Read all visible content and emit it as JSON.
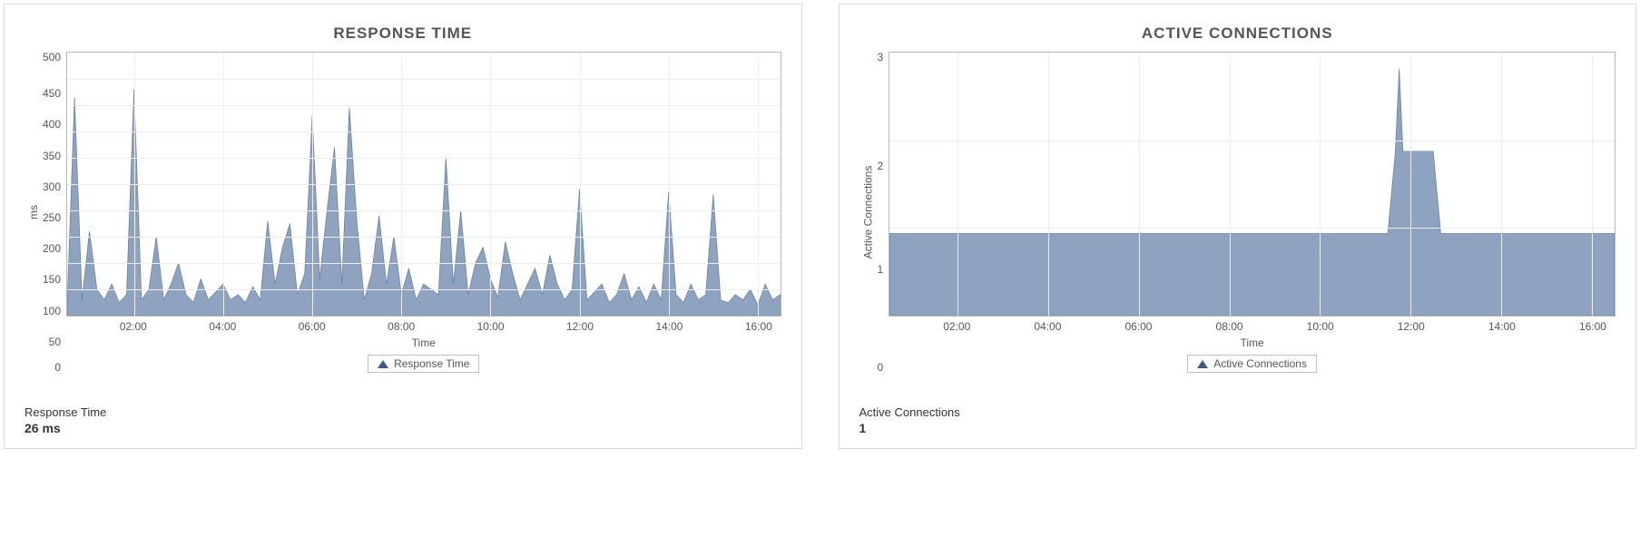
{
  "colors": {
    "series_fill": "#8da3bf",
    "series_stroke": "#6a82a3",
    "panel_border": "#d9d9d9"
  },
  "left": {
    "title": "RESPONSE TIME",
    "ylabel": "ms",
    "xlabel": "Time",
    "legend": "Response Time",
    "summary_label": "Response Time",
    "summary_value": "26 ms",
    "yticks": [
      "500",
      "450",
      "400",
      "350",
      "300",
      "250",
      "200",
      "150",
      "100",
      "50",
      "0"
    ],
    "xticks": [
      "02:00",
      "04:00",
      "06:00",
      "08:00",
      "10:00",
      "12:00",
      "14:00",
      "16:00"
    ]
  },
  "right": {
    "title": "ACTIVE CONNECTIONS",
    "ylabel": "Active Connections",
    "xlabel": "Time",
    "legend": "Active Connections",
    "summary_label": "Active Connections",
    "summary_value": "1",
    "yticks": [
      "3",
      "2",
      "1",
      "0"
    ],
    "xticks": [
      "02:00",
      "04:00",
      "06:00",
      "08:00",
      "10:00",
      "12:00",
      "14:00",
      "16:00"
    ]
  },
  "chart_data": [
    {
      "type": "area",
      "title": "RESPONSE TIME",
      "xlabel": "Time",
      "ylabel": "ms",
      "ylim": [
        0,
        500
      ],
      "xlim": [
        "00:30",
        "16:30"
      ],
      "x_tick_labels": [
        "02:00",
        "04:00",
        "06:00",
        "08:00",
        "10:00",
        "12:00",
        "14:00",
        "16:00"
      ],
      "series": [
        {
          "name": "Response Time",
          "x": [
            "00:30",
            "00:40",
            "00:50",
            "01:00",
            "01:10",
            "01:20",
            "01:30",
            "01:40",
            "01:50",
            "02:00",
            "02:10",
            "02:20",
            "02:30",
            "02:40",
            "02:50",
            "03:00",
            "03:10",
            "03:20",
            "03:30",
            "03:40",
            "03:50",
            "04:00",
            "04:10",
            "04:20",
            "04:30",
            "04:40",
            "04:50",
            "05:00",
            "05:10",
            "05:20",
            "05:30",
            "05:40",
            "05:50",
            "06:00",
            "06:10",
            "06:20",
            "06:30",
            "06:40",
            "06:50",
            "07:00",
            "07:10",
            "07:20",
            "07:30",
            "07:40",
            "07:50",
            "08:00",
            "08:10",
            "08:20",
            "08:30",
            "08:40",
            "08:50",
            "09:00",
            "09:10",
            "09:20",
            "09:30",
            "09:40",
            "09:50",
            "10:00",
            "10:10",
            "10:20",
            "10:30",
            "10:40",
            "10:50",
            "11:00",
            "11:10",
            "11:20",
            "11:30",
            "11:40",
            "11:50",
            "12:00",
            "12:10",
            "12:20",
            "12:30",
            "12:40",
            "12:50",
            "13:00",
            "13:10",
            "13:20",
            "13:30",
            "13:40",
            "13:50",
            "14:00",
            "14:10",
            "14:20",
            "14:30",
            "14:40",
            "14:50",
            "15:00",
            "15:10",
            "15:20",
            "15:30",
            "15:40",
            "15:50",
            "16:00",
            "16:10",
            "16:20",
            "16:30"
          ],
          "values": [
            20,
            415,
            30,
            160,
            50,
            30,
            60,
            25,
            40,
            430,
            30,
            50,
            150,
            30,
            60,
            100,
            40,
            25,
            70,
            30,
            45,
            60,
            30,
            40,
            25,
            55,
            30,
            180,
            60,
            130,
            175,
            40,
            80,
            380,
            70,
            200,
            320,
            60,
            395,
            180,
            30,
            80,
            190,
            60,
            150,
            40,
            90,
            30,
            60,
            50,
            40,
            300,
            60,
            200,
            40,
            100,
            130,
            70,
            35,
            140,
            80,
            30,
            60,
            90,
            40,
            115,
            60,
            30,
            50,
            240,
            30,
            45,
            60,
            25,
            40,
            80,
            30,
            55,
            25,
            60,
            30,
            235,
            40,
            25,
            60,
            30,
            40,
            230,
            30,
            25,
            40,
            30,
            50,
            20,
            60,
            30,
            40
          ]
        }
      ]
    },
    {
      "type": "area",
      "title": "ACTIVE CONNECTIONS",
      "xlabel": "Time",
      "ylabel": "Active Connections",
      "ylim": [
        0,
        3.2
      ],
      "xlim": [
        "00:30",
        "16:30"
      ],
      "x_tick_labels": [
        "02:00",
        "04:00",
        "06:00",
        "08:00",
        "10:00",
        "12:00",
        "14:00",
        "16:00"
      ],
      "series": [
        {
          "name": "Active Connections",
          "x": [
            "00:30",
            "11:30",
            "11:40",
            "11:45",
            "11:50",
            "12:00",
            "12:30",
            "12:40",
            "13:00",
            "16:30"
          ],
          "values": [
            1,
            1,
            2,
            3,
            2,
            2,
            2,
            1,
            1,
            1
          ]
        }
      ]
    }
  ]
}
